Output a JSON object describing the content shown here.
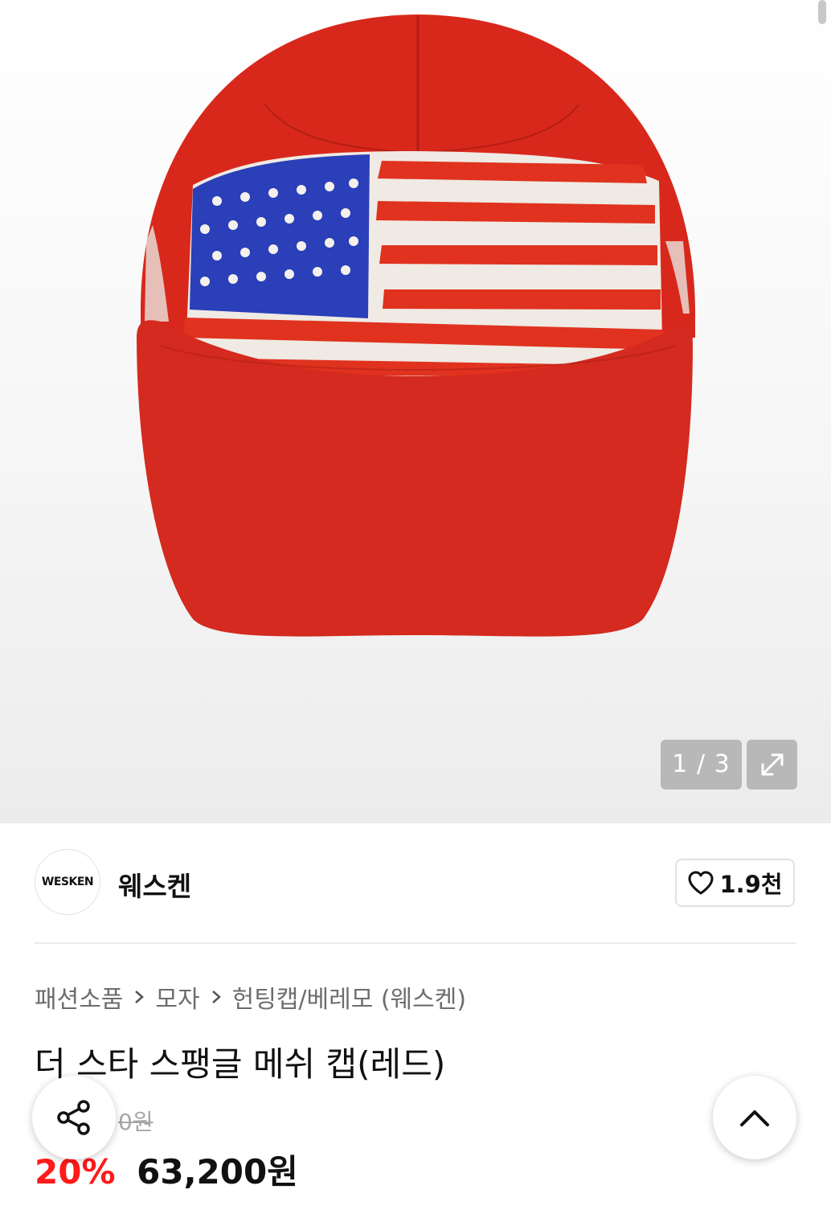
{
  "gallery": {
    "current": "1",
    "separator": "/",
    "total": "3",
    "expand_icon": "expand-arrows-icon"
  },
  "brand": {
    "logo_text": "WESKEN",
    "name": "웨스켄",
    "like_icon": "heart-outline-icon",
    "like_count": "1.9천"
  },
  "breadcrumb": [
    "패션소품",
    "모자",
    "헌팅캡/베레모 (웨스켄)"
  ],
  "product": {
    "title": "더 스타 스팽글 메쉬 캡(레드)",
    "original_price_visible": "0원",
    "discount": "20%",
    "price": "63,200원"
  },
  "floating": {
    "share_icon": "share-icon",
    "top_icon": "chevron-up-icon"
  },
  "colors": {
    "discount": "#ff1a1a",
    "cap_red": "#d42a1f",
    "flag_blue": "#2a3fb8"
  }
}
